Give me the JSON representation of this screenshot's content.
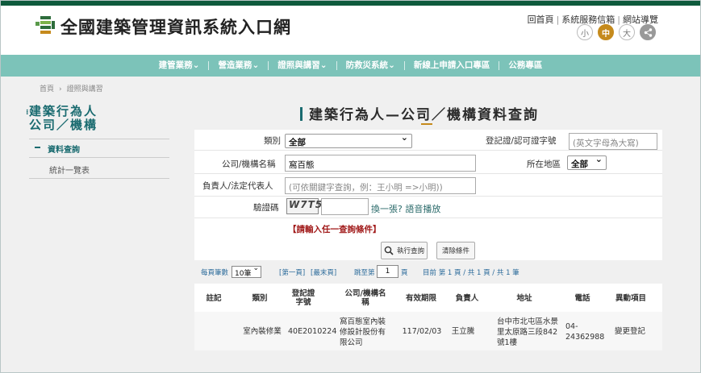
{
  "header": {
    "site_title": "全國建築管理資訊系統入口網",
    "links": [
      "回首頁",
      "系統服務信箱",
      "網站導覽"
    ],
    "font_sizes": [
      "小",
      "中",
      "大"
    ],
    "brand_color": "#0e5a3c",
    "accent_color": "#c58a1c"
  },
  "nav": {
    "items": [
      "建管業務",
      "營造業務",
      "證照與講習",
      "防救災系統",
      "新線上申請入口專區",
      "公務專區"
    ],
    "dropdown_items": [
      true,
      true,
      true,
      true,
      false,
      false
    ],
    "bg_color": "#7cc3b9"
  },
  "breadcrumb": [
    "首頁",
    "證照與講習"
  ],
  "sidebar": {
    "title_line1": "建築行為人",
    "title_line2": "公司／機構",
    "items": [
      {
        "label": "資料查詢",
        "active": true
      },
      {
        "label": "統計一覽表",
        "active": false
      }
    ]
  },
  "main": {
    "title": "建築行為人—公司／機構資料查詢"
  },
  "form": {
    "category_label": "類別",
    "category_value": "全部",
    "reg_label": "登記證/認可證字號",
    "reg_placeholder": "(英文字母為大寫)",
    "company_label": "公司/機構名稱",
    "company_value": "窩百態",
    "region_label": "所在地區",
    "region_value": "全部",
    "owner_label": "負責人/法定代表人",
    "owner_placeholder": "(可依關鍵字查詢，例：王小明 =>小明))",
    "captcha_label": "驗證碼",
    "captcha_text": "W7T5",
    "captcha_refresh": "換一張?",
    "captcha_audio": "語音播放",
    "warning": "【請輸入任一查詢條件】",
    "search_button": "執行查詢",
    "clear_button": "清除條件"
  },
  "pager": {
    "per_page_label": "每頁筆數",
    "per_page_value": "10筆",
    "first": "[第一頁]",
    "last": "[最末頁]",
    "goto_label": "跳至第",
    "goto_value": "1",
    "page_unit": "頁",
    "summary": "目前 第 1 頁 / 共 1 頁 / 共 1 筆"
  },
  "table": {
    "headers": [
      "註記",
      "類別",
      "登記證字號",
      "公司/機構名稱",
      "有效期限",
      "負責人",
      "地址",
      "電話",
      "異動項目"
    ],
    "rows": [
      [
        "",
        "室內裝修業",
        "40E2010224",
        "窩百態室內裝修設計股份有限公司",
        "117/02/03",
        "王立騰",
        "台中市北屯區水景里太原路三段842號1樓",
        "04-24362988",
        "變更登記"
      ]
    ]
  }
}
